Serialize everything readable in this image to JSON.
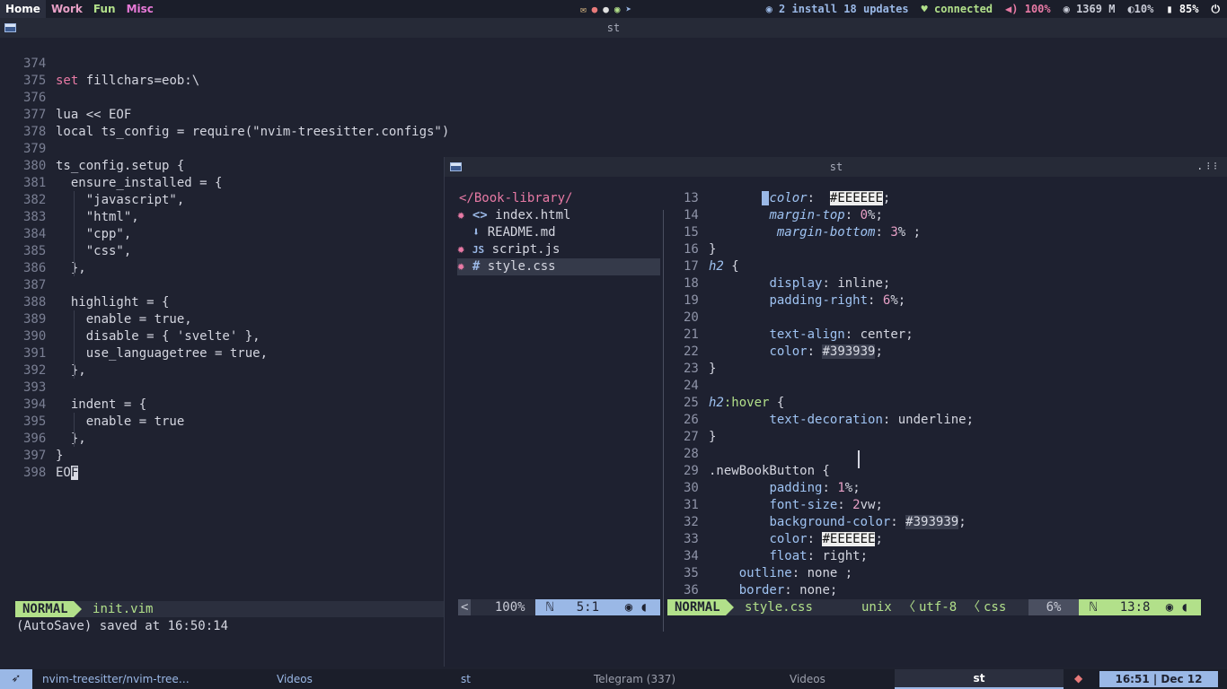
{
  "topbar": {
    "workspaces": [
      {
        "label": "Home",
        "color": "#ffffff"
      },
      {
        "label": "Work",
        "color": "#e8a0c6"
      },
      {
        "label": "Fun",
        "color": "#b2e08a"
      },
      {
        "label": "Misc",
        "color": "#e87ad8"
      }
    ],
    "updates": "2 install 18 updates",
    "network": "connected",
    "volume": "100%",
    "memory": "1369 M",
    "brightness": "10%",
    "battery": "85%"
  },
  "left_window": {
    "title": "st",
    "lines": [
      {
        "n": "374",
        "t": ""
      },
      {
        "n": "375",
        "t": "set fillchars=eob:\\"
      },
      {
        "n": "376",
        "t": ""
      },
      {
        "n": "377",
        "t": "lua << EOF"
      },
      {
        "n": "378",
        "t": "local ts_config = require(\"nvim-treesitter.configs\")"
      },
      {
        "n": "379",
        "t": ""
      },
      {
        "n": "380",
        "t": "ts_config.setup {"
      },
      {
        "n": "381",
        "t": "  ensure_installed = {"
      },
      {
        "n": "382",
        "t": "    \"javascript\","
      },
      {
        "n": "383",
        "t": "    \"html\","
      },
      {
        "n": "384",
        "t": "    \"cpp\","
      },
      {
        "n": "385",
        "t": "    \"css\","
      },
      {
        "n": "386",
        "t": "  },"
      },
      {
        "n": "387",
        "t": ""
      },
      {
        "n": "388",
        "t": "  highlight = {"
      },
      {
        "n": "389",
        "t": "    enable = true,"
      },
      {
        "n": "390",
        "t": "    disable = { 'svelte' },"
      },
      {
        "n": "391",
        "t": "    use_languagetree = true,"
      },
      {
        "n": "392",
        "t": "  },"
      },
      {
        "n": "393",
        "t": ""
      },
      {
        "n": "394",
        "t": "  indent = {"
      },
      {
        "n": "395",
        "t": "    enable = true"
      },
      {
        "n": "396",
        "t": "  },"
      },
      {
        "n": "397",
        "t": "}"
      },
      {
        "n": "398",
        "t": "EO",
        "cur": "F"
      }
    ],
    "mode": "NORMAL",
    "file": "init.vim",
    "message": "(AutoSave) saved at 16:50:14"
  },
  "right_window": {
    "title": "st",
    "tree_root": "</Book-library/",
    "files": [
      {
        "icon": "<>",
        "name": "index.html",
        "mod": true
      },
      {
        "icon": "⬇",
        "name": "README.md",
        "mod": false
      },
      {
        "icon": "JS",
        "name": "script.js",
        "mod": true
      },
      {
        "icon": "#",
        "name": "style.css",
        "mod": true
      }
    ],
    "tree_status": {
      "arrow": "<",
      "pct": "100%",
      "pos": "5:1"
    },
    "code": [
      {
        "n": "13",
        "i": "        ",
        "p": "color",
        "v": "#EEEEEE",
        "kind": "hexw",
        "cur": true,
        "it": true
      },
      {
        "n": "14",
        "i": "        ",
        "p": "margin-top",
        "v": "0%",
        "kind": "num",
        "it": true
      },
      {
        "n": "15",
        "i": "         ",
        "p": "margin-bottom",
        "v": "3% ",
        "kind": "num",
        "it": true
      },
      {
        "n": "16",
        "raw": "}"
      },
      {
        "n": "17",
        "sel": "h2 {"
      },
      {
        "n": "18",
        "i": "        ",
        "p": "display",
        "v": "inline",
        "kind": "val"
      },
      {
        "n": "19",
        "i": "        ",
        "p": "padding-right",
        "v": "6%",
        "kind": "num"
      },
      {
        "n": "20",
        "raw": ""
      },
      {
        "n": "21",
        "i": "        ",
        "p": "text-align",
        "v": "center",
        "kind": "val"
      },
      {
        "n": "22",
        "i": "        ",
        "p": "color",
        "v": "#393939",
        "kind": "hex"
      },
      {
        "n": "23",
        "raw": "}"
      },
      {
        "n": "24",
        "raw": ""
      },
      {
        "n": "25",
        "sel": "h2:hover {"
      },
      {
        "n": "26",
        "i": "        ",
        "p": "text-decoration",
        "v": "underline",
        "kind": "val"
      },
      {
        "n": "27",
        "raw": "}"
      },
      {
        "n": "28",
        "raw": ""
      },
      {
        "n": "29",
        "raw": ".newBookButton {"
      },
      {
        "n": "30",
        "i": "        ",
        "p": "padding",
        "v": "1%",
        "kind": "num"
      },
      {
        "n": "31",
        "i": "        ",
        "p": "font-size",
        "v": "2vw",
        "kind": "num"
      },
      {
        "n": "32",
        "i": "        ",
        "p": "background-color",
        "v": "#393939",
        "kind": "hex"
      },
      {
        "n": "33",
        "i": "        ",
        "p": "color",
        "v": "#EEEEEE",
        "kind": "hexw"
      },
      {
        "n": "34",
        "i": "        ",
        "p": "float",
        "v": "right",
        "kind": "val"
      },
      {
        "n": "35",
        "i": "    ",
        "p": "outline",
        "v": "none ",
        "kind": "val"
      },
      {
        "n": "36",
        "i": "    ",
        "p": "border",
        "v": "none",
        "kind": "val"
      }
    ],
    "status": {
      "mode": "NORMAL",
      "file": "style.css",
      "format": "unix",
      "enc": "utf-8",
      "ft": "css",
      "pct": "6%",
      "pos": "13:8"
    }
  },
  "taskbar": {
    "items": [
      "nvim-treesitter/nvim-tree…",
      "Videos",
      "st",
      "Telegram (337)",
      "Videos",
      "st"
    ],
    "clock": "16:51 | Dec 12"
  }
}
